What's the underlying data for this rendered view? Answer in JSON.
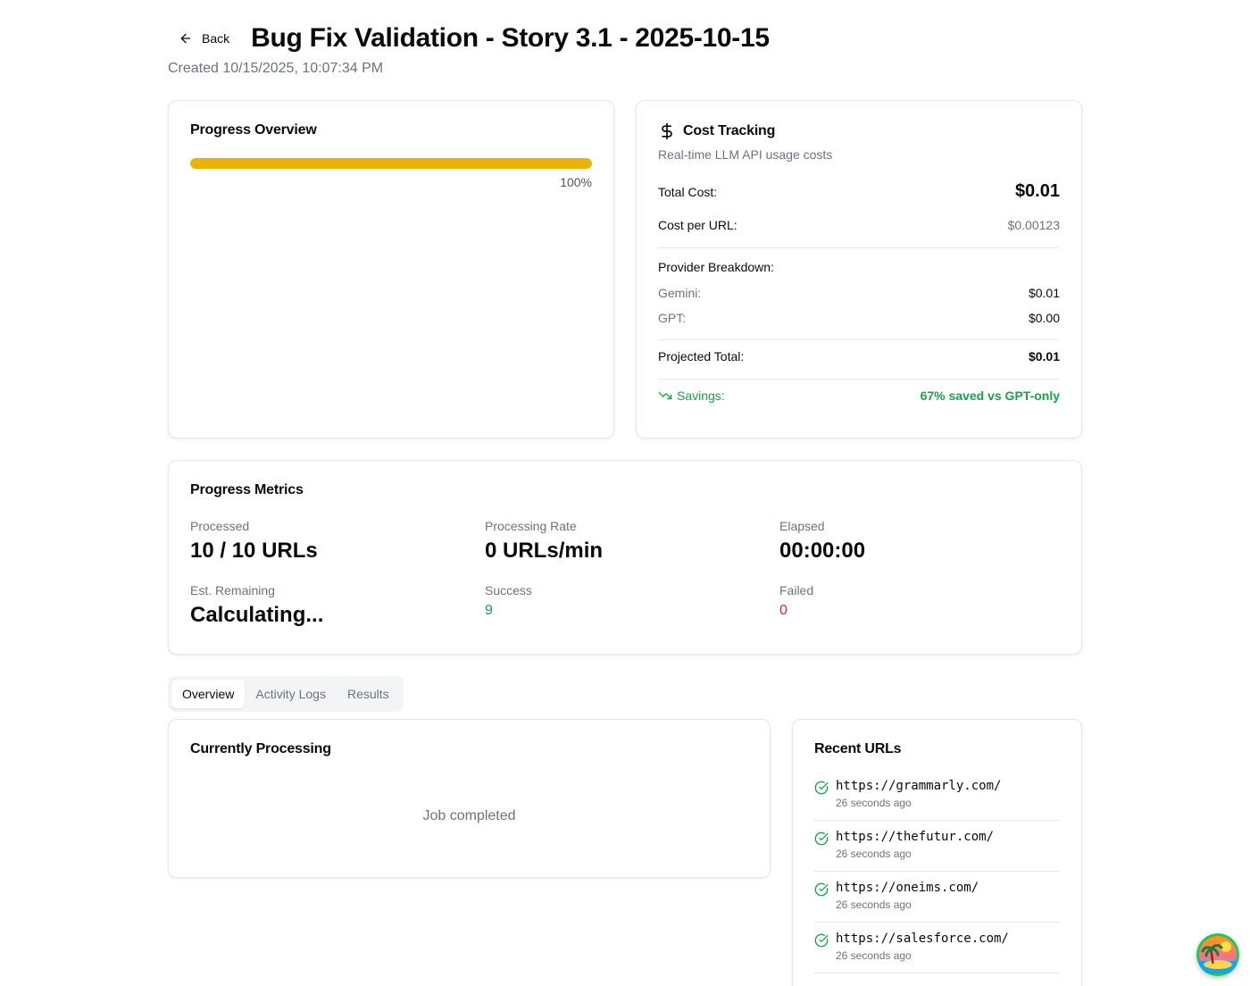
{
  "header": {
    "back_label": "Back",
    "title": "Bug Fix Validation - Story 3.1 - 2025-10-15",
    "created": "Created 10/15/2025, 10:07:34 PM"
  },
  "progress_overview": {
    "title": "Progress Overview",
    "percent_label": "100%",
    "percent": 100,
    "bar_color": "#eab308"
  },
  "cost_tracking": {
    "title": "Cost Tracking",
    "subtitle": "Real-time LLM API usage costs",
    "total_cost_label": "Total Cost:",
    "total_cost": "$0.01",
    "cost_per_url_label": "Cost per URL:",
    "cost_per_url": "$0.00123",
    "provider_breakdown_label": "Provider Breakdown:",
    "providers": [
      {
        "name": "Gemini:",
        "cost": "$0.01"
      },
      {
        "name": "GPT:",
        "cost": "$0.00"
      }
    ],
    "projected_total_label": "Projected Total:",
    "projected_total": "$0.01",
    "savings_label": "Savings:",
    "savings_value": "67% saved vs GPT-only",
    "savings_color": "#16a34a"
  },
  "progress_metrics": {
    "title": "Progress Metrics",
    "processed_label": "Processed",
    "processed_value": "10 / 10 URLs",
    "rate_label": "Processing Rate",
    "rate_value": "0 URLs/min",
    "elapsed_label": "Elapsed",
    "elapsed_value": "00:00:00",
    "remaining_label": "Est. Remaining",
    "remaining_value": "Calculating...",
    "success_label": "Success",
    "success_value": "9",
    "failed_label": "Failed",
    "failed_value": "0"
  },
  "tabs": [
    {
      "label": "Overview",
      "active": true
    },
    {
      "label": "Activity Logs",
      "active": false
    },
    {
      "label": "Results",
      "active": false
    }
  ],
  "currently_processing": {
    "title": "Currently Processing",
    "status": "Job completed"
  },
  "recent_urls": {
    "title": "Recent URLs",
    "items": [
      {
        "url": "https://grammarly.com/",
        "time": "26 seconds ago"
      },
      {
        "url": "https://thefutur.com/",
        "time": "26 seconds ago"
      },
      {
        "url": "https://oneims.com/",
        "time": "26 seconds ago"
      },
      {
        "url": "https://salesforce.com/",
        "time": "26 seconds ago"
      }
    ]
  }
}
